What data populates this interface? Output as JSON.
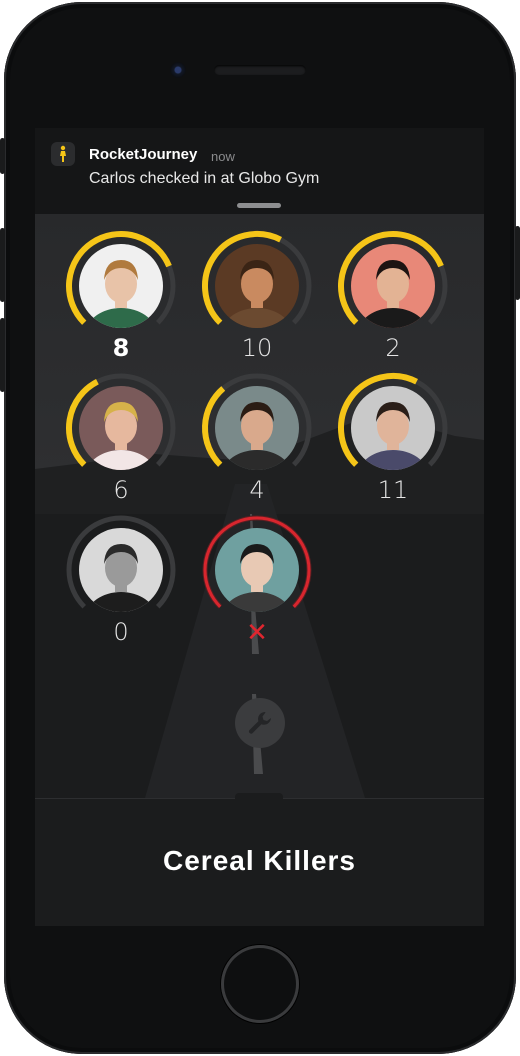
{
  "notification": {
    "app_name": "RocketJourney",
    "time": "now",
    "message": "Carlos checked in at Globo Gym"
  },
  "members": [
    {
      "score": "8",
      "progress": 0.75,
      "status": "active",
      "avatar_bg": "#f0f0f0",
      "skin": "#e8c3a8",
      "hair": "#b07a3e",
      "shirt": "#2e6b4a"
    },
    {
      "score": "10",
      "progress": 0.6,
      "status": "active",
      "avatar_bg": "#5b3a24",
      "skin": "#c98a60",
      "hair": "#3a2415",
      "shirt": "#6b4a30"
    },
    {
      "score": "2",
      "progress": 0.75,
      "status": "active",
      "avatar_bg": "#e88878",
      "skin": "#e3b394",
      "hair": "#1d1412",
      "shirt": "#1a1a1a"
    },
    {
      "score": "6",
      "progress": 0.4,
      "status": "active",
      "avatar_bg": "#7a5a5a",
      "skin": "#e6b89e",
      "hair": "#d6b24a",
      "shirt": "#f2e6e6"
    },
    {
      "score": "4",
      "progress": 0.35,
      "status": "active",
      "avatar_bg": "#7a8a8a",
      "skin": "#d9a98c",
      "hair": "#2a1c14",
      "shirt": "#2b2b2b"
    },
    {
      "score": "11",
      "progress": 0.6,
      "status": "active",
      "avatar_bg": "#c9c9c9",
      "skin": "#e0b49a",
      "hair": "#2a1e18",
      "shirt": "#4a4a6a"
    },
    {
      "score": "0",
      "progress": 0.0,
      "status": "inactive",
      "avatar_bg": "#d9d9d9",
      "skin": "#9a9a9a",
      "hair": "#2a2a2a",
      "shirt": "#1d1d1d"
    },
    {
      "score": "✕",
      "progress": 1.0,
      "status": "failed",
      "avatar_bg": "#6fa0a0",
      "skin": "#e8c9b4",
      "hair": "#1a1a1a",
      "shirt": "#3a3a3a"
    }
  ],
  "team_name": "Cereal Killers",
  "colors": {
    "accent": "#f5c518",
    "failed": "#d8262e",
    "track": "#3a3b3d"
  },
  "icons": {
    "app": "rocket-runner-icon",
    "settings": "wrench-icon",
    "failed": "x-icon"
  }
}
